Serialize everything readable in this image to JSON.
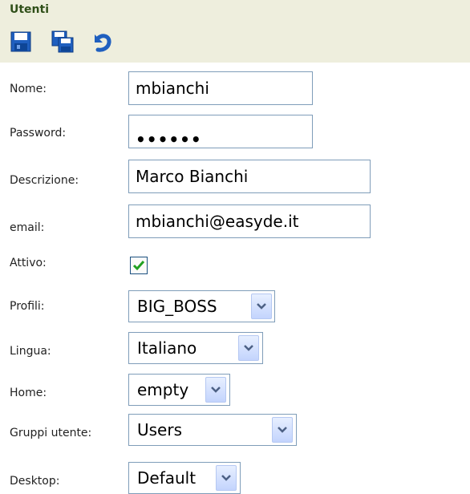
{
  "header": {
    "title": "Utenti"
  },
  "toolbar": {
    "icons": [
      "save-icon",
      "save-all-icon",
      "undo-icon"
    ]
  },
  "form": {
    "name": {
      "label": "Nome:",
      "value": "mbianchi"
    },
    "password": {
      "label": "Password:",
      "value": "••••••"
    },
    "description": {
      "label": "Descrizione:",
      "value": "Marco Bianchi"
    },
    "email": {
      "label": "email:",
      "value": "mbianchi@easyde.it"
    },
    "active": {
      "label": "Attivo:",
      "checked": true
    },
    "profiles": {
      "label": "Profili:",
      "selected": "BIG_BOSS"
    },
    "language": {
      "label": "Lingua:",
      "selected": "Italiano"
    },
    "home": {
      "label": "Home:",
      "selected": "empty"
    },
    "user_groups": {
      "label": "Gruppi utente:",
      "selected": "Users"
    },
    "desktop": {
      "label": "Desktop:",
      "selected": "Default"
    }
  },
  "colors": {
    "header_bg": "#eeeedd",
    "title": "#2f4f18",
    "input_border": "#7f9db9",
    "check": "#21a121"
  }
}
